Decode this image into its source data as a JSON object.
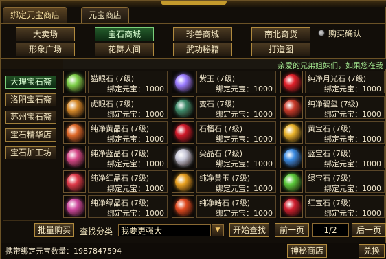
{
  "tabs": [
    {
      "label": "绑定元宝商店",
      "active": true
    },
    {
      "label": "元宝商店",
      "active": false
    }
  ],
  "categories": [
    {
      "label": "大卖场",
      "selected": false
    },
    {
      "label": "宝石商城",
      "selected": true
    },
    {
      "label": "珍兽商城",
      "selected": false
    },
    {
      "label": "南北奇货",
      "selected": false
    },
    {
      "label": "形象广场",
      "selected": false
    },
    {
      "label": "花舞人间",
      "selected": false
    },
    {
      "label": "武功秘籍",
      "selected": false
    },
    {
      "label": "打造图",
      "selected": false
    }
  ],
  "purchase_confirm_label": "购买确认",
  "marquee": "亲爱的兄弟姐妹们，如果您在我",
  "shops": [
    {
      "label": "大理宝石斋",
      "selected": true
    },
    {
      "label": "洛阳宝石斋",
      "selected": false
    },
    {
      "label": "苏州宝石斋",
      "selected": false
    },
    {
      "label": "宝石精华店",
      "selected": false
    },
    {
      "label": "宝石加工坊",
      "selected": false
    }
  ],
  "price_label": "绑定元宝：1000",
  "items": [
    {
      "name": "猫眼石 (7级)",
      "gem_icon": "cat-eye-gem-icon",
      "color": "#7fd04a"
    },
    {
      "name": "紫玉 (7级)",
      "gem_icon": "purple-jade-gem-icon",
      "color": "#9a7cff"
    },
    {
      "name": "纯净月光石 (7级)",
      "gem_icon": "moonstone-gem-icon",
      "color": "#e0202a"
    },
    {
      "name": "虎眼石 (7级)",
      "gem_icon": "tiger-eye-gem-icon",
      "color": "#d68a2a"
    },
    {
      "name": "变石 (7级)",
      "gem_icon": "alexandrite-gem-icon",
      "color": "#3d8a6a"
    },
    {
      "name": "纯净碧玺 (7级)",
      "gem_icon": "tourmaline-gem-icon",
      "color": "#c83a2a"
    },
    {
      "name": "纯净黄晶石 (7级)",
      "gem_icon": "citrine-gem-icon",
      "color": "#e06a2a"
    },
    {
      "name": "石榴石 (7级)",
      "gem_icon": "garnet-gem-icon",
      "color": "#d01a2a"
    },
    {
      "name": "黄宝石 (7级)",
      "gem_icon": "topaz-gem-icon",
      "color": "#e8b22a"
    },
    {
      "name": "纯净蓝晶石 (7级)",
      "gem_icon": "blue-crystal-gem-icon",
      "color": "#d84a8a"
    },
    {
      "name": "尖晶石 (7级)",
      "gem_icon": "spinel-gem-icon",
      "color": "#c8c8d8"
    },
    {
      "name": "蓝宝石 (7级)",
      "gem_icon": "sapphire-gem-icon",
      "color": "#3a8ae0"
    },
    {
      "name": "纯净红晶石 (7级)",
      "gem_icon": "red-crystal-gem-icon",
      "color": "#e03a4a"
    },
    {
      "name": "纯净黄玉 (7级)",
      "gem_icon": "yellow-jade-gem-icon",
      "color": "#e8a020"
    },
    {
      "name": "绿宝石 (7级)",
      "gem_icon": "emerald-gem-icon",
      "color": "#5ac83a"
    },
    {
      "name": "纯净绿晶石 (7级)",
      "gem_icon": "green-crystal-gem-icon",
      "color": "#d04aa0"
    },
    {
      "name": "纯净皓石 (7级)",
      "gem_icon": "zircon-gem-icon",
      "color": "#e04a20"
    },
    {
      "name": "红宝石 (7级)",
      "gem_icon": "ruby-gem-icon",
      "color": "#d02030"
    }
  ],
  "bottom": {
    "bulk_buy": "批量购买",
    "search_label": "查找分类",
    "search_value": "我要更强大",
    "start_search": "开始查找",
    "prev_page": "前一页",
    "page": "1/2",
    "next_page": "后一页"
  },
  "footer": {
    "money_text": "携带绑定元宝数量：1987847594",
    "mystery_shop": "神秘商店",
    "exchange": "兑换"
  }
}
